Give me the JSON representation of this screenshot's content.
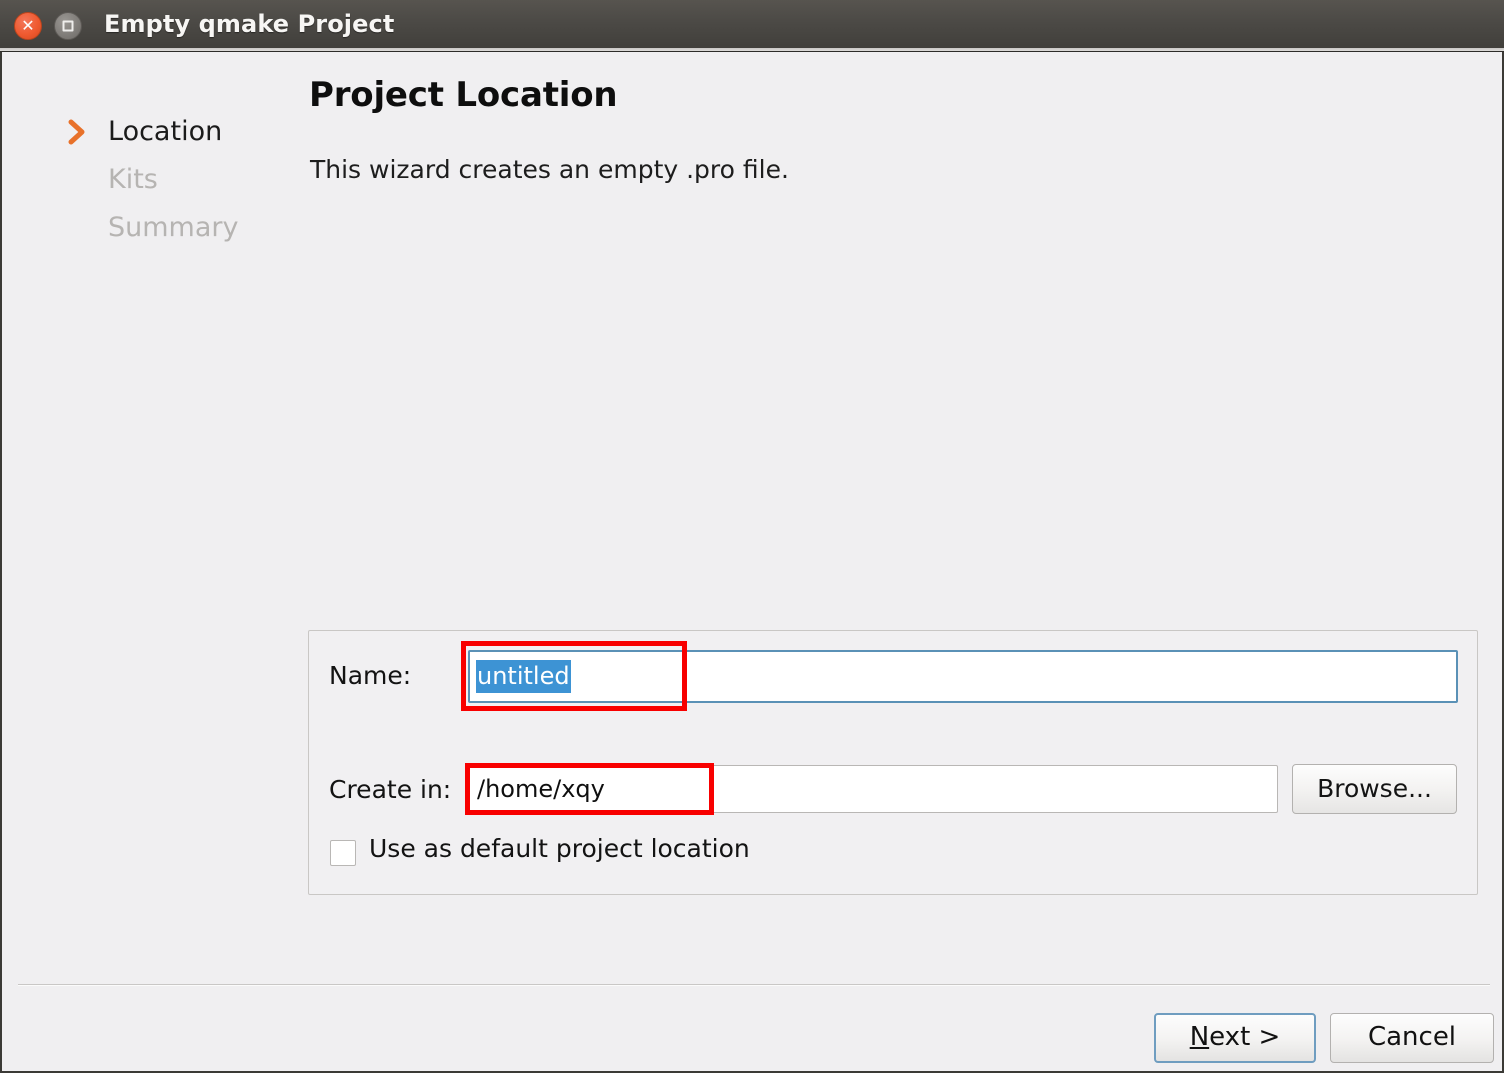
{
  "window": {
    "title": "Empty qmake Project",
    "controls": [
      {
        "name": "close",
        "glyph": "✕"
      },
      {
        "name": "maximize",
        "glyph": ""
      }
    ]
  },
  "steps": [
    {
      "label": "Location",
      "state": "current"
    },
    {
      "label": "Kits",
      "state": "pending"
    },
    {
      "label": "Summary",
      "state": "pending"
    }
  ],
  "header": {
    "title": "Project Location",
    "subtitle": "This wizard creates an empty .pro file."
  },
  "form": {
    "name_label": "Name:",
    "name_value": "untitled",
    "name_placeholder": "",
    "createin_label": "Create in:",
    "createin_value": "/home/xqy",
    "createin_placeholder": "",
    "browse_label": "Browse...",
    "checkbox_label": "Use as default project location",
    "checkbox_checked": false
  },
  "footer": {
    "next_mnemonic": "N",
    "next_rest": "ext >",
    "cancel_label": "Cancel"
  },
  "annotations": [
    {
      "target": "name-input",
      "color": "#f80000"
    },
    {
      "target": "createin-input",
      "color": "#f80000"
    }
  ],
  "colors": {
    "titlebar_dark": "#403e3a",
    "close_orange": "#ef5a30",
    "accent_chevron": "#e8712a",
    "selection_blue": "#3d93d4",
    "focus_blue": "#6f9dc0",
    "annotation_red": "#f80000",
    "dialog_bg": "#f0eff1",
    "pending_step": "#b6b4b2"
  }
}
